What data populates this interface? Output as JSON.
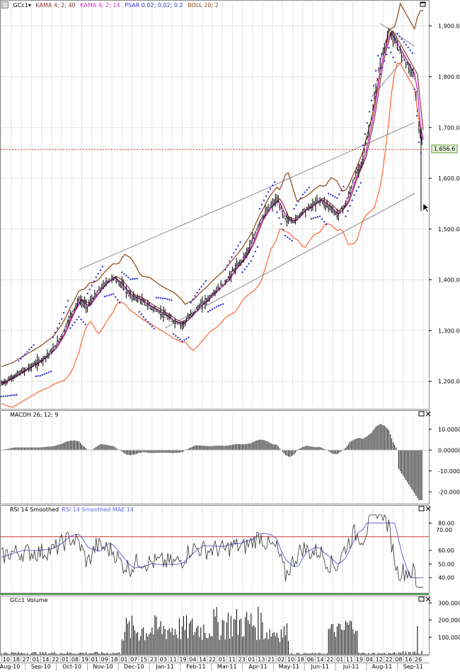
{
  "colors": {
    "kama40": "#8b3a3a",
    "kama14": "#cc33cc",
    "psar": "#3333cc",
    "boll": "#8b4513",
    "bollmid": "#ff6633",
    "price": "#000000",
    "rsi": "#333333",
    "rsima": "#6666dd",
    "ref": "#cc3333"
  },
  "legend": {
    "symbol": "GCc1",
    "items": [
      "KAMA 4; 2; 40",
      "KAMA 4; 2; 14",
      "PSAR 0.02; 0.02; 0.2",
      "BOLL 20; 2"
    ]
  },
  "price_box": {
    "value": "1,656.6"
  },
  "panels": {
    "macd": {
      "title": "MACDH 26; 12; 9"
    },
    "rsi": {
      "title": "RSI 14 Smoothed",
      "title2": "RSI 14 Smoothed MAE 14",
      "ref_label": "70.00"
    },
    "volume": {
      "title": "GCc1 Volume"
    }
  },
  "chart_data": [
    {
      "type": "candlestick",
      "name": "price",
      "ylim": [
        1150,
        1940
      ],
      "yticks": [
        "1,900.000",
        "1,800.000",
        "1,700.000",
        "1,600.000",
        "1,500.000",
        "1,400.000",
        "1,300.000",
        "1,200.000"
      ],
      "ytickvals": [
        1900,
        1800,
        1700,
        1600,
        1500,
        1400,
        1300,
        1200
      ],
      "ref_line": 1656.6,
      "path": [
        [
          0,
          1195
        ],
        [
          3,
          1210
        ],
        [
          6,
          1225
        ],
        [
          9,
          1240
        ],
        [
          12,
          1262
        ],
        [
          14,
          1290
        ],
        [
          16,
          1330
        ],
        [
          18,
          1360
        ],
        [
          20,
          1348
        ],
        [
          22,
          1372
        ],
        [
          24,
          1392
        ],
        [
          26,
          1405
        ],
        [
          28,
          1390
        ],
        [
          30,
          1368
        ],
        [
          32,
          1362
        ],
        [
          34,
          1350
        ],
        [
          36,
          1340
        ],
        [
          38,
          1330
        ],
        [
          40,
          1318
        ],
        [
          42,
          1312
        ],
        [
          44,
          1330
        ],
        [
          46,
          1348
        ],
        [
          48,
          1362
        ],
        [
          50,
          1380
        ],
        [
          52,
          1395
        ],
        [
          54,
          1420
        ],
        [
          56,
          1440
        ],
        [
          58,
          1470
        ],
        [
          60,
          1515
        ],
        [
          62,
          1540
        ],
        [
          64,
          1558
        ],
        [
          66,
          1520
        ],
        [
          68,
          1515
        ],
        [
          70,
          1535
        ],
        [
          72,
          1545
        ],
        [
          74,
          1558
        ],
        [
          76,
          1545
        ],
        [
          78,
          1528
        ],
        [
          80,
          1550
        ],
        [
          82,
          1600
        ],
        [
          84,
          1640
        ],
        [
          86,
          1720
        ],
        [
          88,
          1830
        ],
        [
          90,
          1890
        ],
        [
          92,
          1860
        ],
        [
          94,
          1830
        ],
        [
          96,
          1800
        ],
        [
          97,
          1700
        ],
        [
          98,
          1660
        ]
      ]
    },
    {
      "type": "bar",
      "name": "MACDH 26; 12; 9",
      "ylim": [
        -25,
        15
      ],
      "yticks": [
        "10.00000",
        "0.00000",
        "-10.00000",
        "-20.00000"
      ],
      "ytickvals": [
        10,
        0,
        -10,
        -20
      ]
    },
    {
      "type": "line",
      "name": "RSI 14 Smoothed",
      "ylim": [
        30,
        88
      ],
      "yticks": [
        "80.00",
        "70.00",
        "60.00",
        "50.00",
        "40.00"
      ],
      "ytickvals": [
        80,
        70,
        60,
        50,
        40
      ],
      "ref": 70
    },
    {
      "type": "bar",
      "name": "GCc1 Volume",
      "ylim": [
        0,
        310000
      ],
      "yticks": [
        "300,000",
        "200,000",
        "100,000"
      ],
      "ytickvals": [
        300000,
        200000,
        100000
      ]
    }
  ],
  "xaxis": {
    "top_row": [
      "10",
      "18",
      "27",
      "01",
      "14",
      "22",
      "01",
      "08",
      "19",
      "01",
      "09",
      "18",
      "01",
      "07",
      "15",
      "23",
      "03",
      "11",
      "19",
      "04",
      "14",
      "22",
      "01",
      "11",
      "23",
      "01",
      "13",
      "21",
      "02",
      "10",
      "18",
      "06",
      "14",
      "22",
      "01",
      "11",
      "19",
      "04",
      "12",
      "22",
      "08",
      "16",
      "26"
    ],
    "months": [
      "Aug-10",
      "Sep-10",
      "Oct-10",
      "Nov-10",
      "Dec-10",
      "Jan-11",
      "Feb-11",
      "Mar-11",
      "Apr-11",
      "May-11",
      "Jun-11",
      "Jul-11",
      "Aug-11",
      "Sep-11"
    ]
  }
}
